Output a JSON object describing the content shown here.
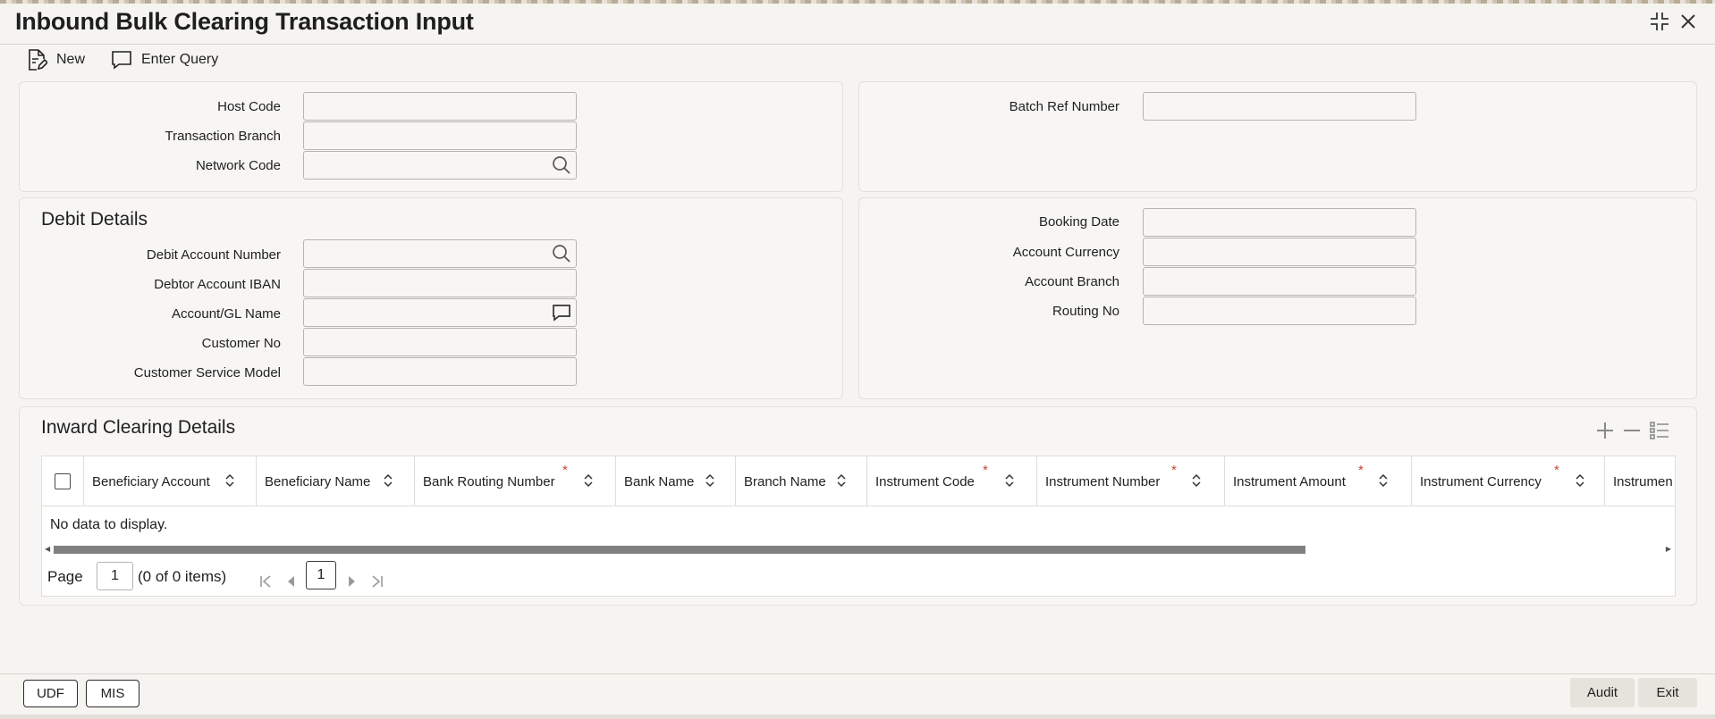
{
  "window": {
    "title": "Inbound Bulk Clearing Transaction Input",
    "controls": [
      {
        "icon": "maximize-icon"
      },
      {
        "icon": "close-icon"
      }
    ]
  },
  "toolbar": {
    "new_label": "New",
    "new_icon": "new-document-icon",
    "enter_query_label": "Enter Query",
    "enter_query_icon": "chat-bubble-icon"
  },
  "header": {
    "host_code_label": "Host Code",
    "host_code_value": "",
    "transaction_branch_label": "Transaction Branch",
    "transaction_branch_value": "",
    "network_code_label": "Network Code",
    "network_code_value": "",
    "batch_ref_label": "Batch Ref Number",
    "batch_ref_value": ""
  },
  "debit_details": {
    "title": "Debit Details",
    "debit_account_label": "Debit Account Number",
    "debtor_iban_label": "Debtor Account IBAN",
    "account_gl_name_label": "Account/GL Name",
    "customer_no_label": "Customer No",
    "customer_service_model_label": "Customer Service Model",
    "booking_date_label": "Booking Date",
    "account_currency_label": "Account Currency",
    "account_branch_label": "Account Branch",
    "routing_no_label": "Routing No"
  },
  "inward_clearing": {
    "title": "Inward Clearing Details",
    "columns": [
      {
        "label": "Beneficiary Account",
        "required": false
      },
      {
        "label": "Beneficiary Name",
        "required": false
      },
      {
        "label": "Bank Routing Number",
        "required": true
      },
      {
        "label": "Bank Name",
        "required": false
      },
      {
        "label": "Branch Name",
        "required": false
      },
      {
        "label": "Instrument Code",
        "required": true
      },
      {
        "label": "Instrument Number",
        "required": true
      },
      {
        "label": "Instrument Amount",
        "required": true
      },
      {
        "label": "Instrument Currency",
        "required": true
      },
      {
        "label": "Instrumen",
        "required": false
      }
    ],
    "required_marker": "*",
    "empty_message": "No data to display.",
    "pager": {
      "page_label": "Page",
      "page_value": "1",
      "items_text": "(0 of 0 items)",
      "current_page": "1"
    }
  },
  "footer": {
    "udf_label": "UDF",
    "mis_label": "MIS",
    "audit_label": "Audit",
    "exit_label": "Exit"
  },
  "colors": {
    "background": "#f6f4f1",
    "required": "#c74634",
    "text": "#1f1f1f"
  }
}
